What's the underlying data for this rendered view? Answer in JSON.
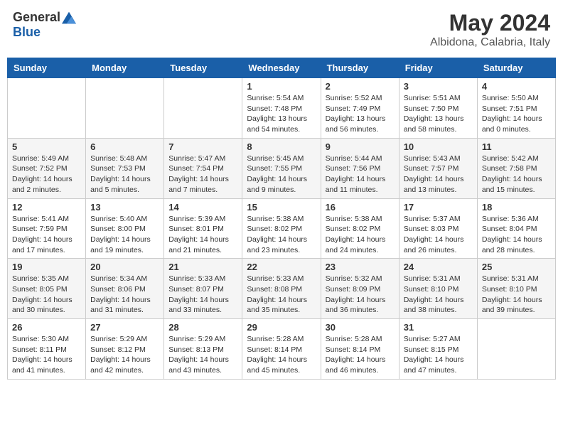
{
  "logo": {
    "general": "General",
    "blue": "Blue"
  },
  "header": {
    "month": "May 2024",
    "location": "Albidona, Calabria, Italy"
  },
  "weekdays": [
    "Sunday",
    "Monday",
    "Tuesday",
    "Wednesday",
    "Thursday",
    "Friday",
    "Saturday"
  ],
  "weeks": [
    [
      {
        "day": "",
        "info": ""
      },
      {
        "day": "",
        "info": ""
      },
      {
        "day": "",
        "info": ""
      },
      {
        "day": "1",
        "info": "Sunrise: 5:54 AM\nSunset: 7:48 PM\nDaylight: 13 hours\nand 54 minutes."
      },
      {
        "day": "2",
        "info": "Sunrise: 5:52 AM\nSunset: 7:49 PM\nDaylight: 13 hours\nand 56 minutes."
      },
      {
        "day": "3",
        "info": "Sunrise: 5:51 AM\nSunset: 7:50 PM\nDaylight: 13 hours\nand 58 minutes."
      },
      {
        "day": "4",
        "info": "Sunrise: 5:50 AM\nSunset: 7:51 PM\nDaylight: 14 hours\nand 0 minutes."
      }
    ],
    [
      {
        "day": "5",
        "info": "Sunrise: 5:49 AM\nSunset: 7:52 PM\nDaylight: 14 hours\nand 2 minutes."
      },
      {
        "day": "6",
        "info": "Sunrise: 5:48 AM\nSunset: 7:53 PM\nDaylight: 14 hours\nand 5 minutes."
      },
      {
        "day": "7",
        "info": "Sunrise: 5:47 AM\nSunset: 7:54 PM\nDaylight: 14 hours\nand 7 minutes."
      },
      {
        "day": "8",
        "info": "Sunrise: 5:45 AM\nSunset: 7:55 PM\nDaylight: 14 hours\nand 9 minutes."
      },
      {
        "day": "9",
        "info": "Sunrise: 5:44 AM\nSunset: 7:56 PM\nDaylight: 14 hours\nand 11 minutes."
      },
      {
        "day": "10",
        "info": "Sunrise: 5:43 AM\nSunset: 7:57 PM\nDaylight: 14 hours\nand 13 minutes."
      },
      {
        "day": "11",
        "info": "Sunrise: 5:42 AM\nSunset: 7:58 PM\nDaylight: 14 hours\nand 15 minutes."
      }
    ],
    [
      {
        "day": "12",
        "info": "Sunrise: 5:41 AM\nSunset: 7:59 PM\nDaylight: 14 hours\nand 17 minutes."
      },
      {
        "day": "13",
        "info": "Sunrise: 5:40 AM\nSunset: 8:00 PM\nDaylight: 14 hours\nand 19 minutes."
      },
      {
        "day": "14",
        "info": "Sunrise: 5:39 AM\nSunset: 8:01 PM\nDaylight: 14 hours\nand 21 minutes."
      },
      {
        "day": "15",
        "info": "Sunrise: 5:38 AM\nSunset: 8:02 PM\nDaylight: 14 hours\nand 23 minutes."
      },
      {
        "day": "16",
        "info": "Sunrise: 5:38 AM\nSunset: 8:02 PM\nDaylight: 14 hours\nand 24 minutes."
      },
      {
        "day": "17",
        "info": "Sunrise: 5:37 AM\nSunset: 8:03 PM\nDaylight: 14 hours\nand 26 minutes."
      },
      {
        "day": "18",
        "info": "Sunrise: 5:36 AM\nSunset: 8:04 PM\nDaylight: 14 hours\nand 28 minutes."
      }
    ],
    [
      {
        "day": "19",
        "info": "Sunrise: 5:35 AM\nSunset: 8:05 PM\nDaylight: 14 hours\nand 30 minutes."
      },
      {
        "day": "20",
        "info": "Sunrise: 5:34 AM\nSunset: 8:06 PM\nDaylight: 14 hours\nand 31 minutes."
      },
      {
        "day": "21",
        "info": "Sunrise: 5:33 AM\nSunset: 8:07 PM\nDaylight: 14 hours\nand 33 minutes."
      },
      {
        "day": "22",
        "info": "Sunrise: 5:33 AM\nSunset: 8:08 PM\nDaylight: 14 hours\nand 35 minutes."
      },
      {
        "day": "23",
        "info": "Sunrise: 5:32 AM\nSunset: 8:09 PM\nDaylight: 14 hours\nand 36 minutes."
      },
      {
        "day": "24",
        "info": "Sunrise: 5:31 AM\nSunset: 8:10 PM\nDaylight: 14 hours\nand 38 minutes."
      },
      {
        "day": "25",
        "info": "Sunrise: 5:31 AM\nSunset: 8:10 PM\nDaylight: 14 hours\nand 39 minutes."
      }
    ],
    [
      {
        "day": "26",
        "info": "Sunrise: 5:30 AM\nSunset: 8:11 PM\nDaylight: 14 hours\nand 41 minutes."
      },
      {
        "day": "27",
        "info": "Sunrise: 5:29 AM\nSunset: 8:12 PM\nDaylight: 14 hours\nand 42 minutes."
      },
      {
        "day": "28",
        "info": "Sunrise: 5:29 AM\nSunset: 8:13 PM\nDaylight: 14 hours\nand 43 minutes."
      },
      {
        "day": "29",
        "info": "Sunrise: 5:28 AM\nSunset: 8:14 PM\nDaylight: 14 hours\nand 45 minutes."
      },
      {
        "day": "30",
        "info": "Sunrise: 5:28 AM\nSunset: 8:14 PM\nDaylight: 14 hours\nand 46 minutes."
      },
      {
        "day": "31",
        "info": "Sunrise: 5:27 AM\nSunset: 8:15 PM\nDaylight: 14 hours\nand 47 minutes."
      },
      {
        "day": "",
        "info": ""
      }
    ]
  ]
}
